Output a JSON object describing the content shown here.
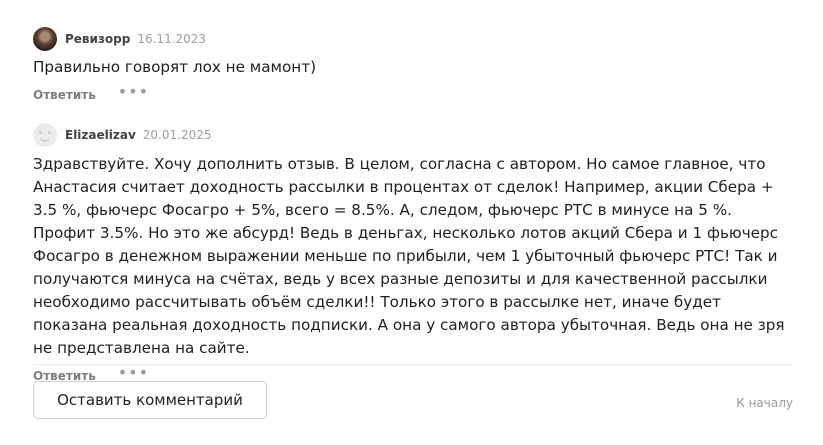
{
  "comments": [
    {
      "author": "Ревизорр",
      "date": "16.11.2023",
      "text": "Правильно говорят лох не мамонт)",
      "reply_label": "Ответить",
      "more_label": "•••"
    },
    {
      "author": "Elizaelizav",
      "date": "20.01.2025",
      "text": "Здравствуйте. Хочу дополнить отзыв. В целом, согласна с автором. Но самое главное, что Анастасия считает доходность рассылки в процентах от сделок! Например, акции Сбера + 3.5 %, фьючерс Фосагро + 5%, всего = 8.5%. А, следом, фьючерс РТС в минусе на 5 %. Профит 3.5%. Но это же абсурд! Ведь в деньгах, несколько лотов акций Сбера и 1 фьючерс Фосагро в денежном выражении меньше по прибыли, чем 1 убыточный фьючерс РТС! Так и получаются минуса на счётах, ведь у всех разные депозиты и для качественной рассылки необходимо рассчитывать объём сделки!! Только этого в рассылке нет, иначе будет показана реальная доходность подписки. А она у самого автора убыточная. Ведь она не зря не представлена на сайте.",
      "reply_label": "Ответить",
      "more_label": "•••"
    }
  ],
  "footer": {
    "leave_comment_label": "Оставить комментарий",
    "to_top_label": "К началу"
  }
}
